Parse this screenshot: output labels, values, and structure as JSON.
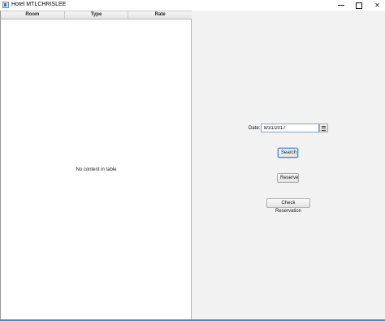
{
  "window": {
    "title": "Hotel MTLCHRISLEE",
    "minimize_icon": "minimize-icon",
    "maximize_icon": "maximize-icon",
    "close_glyph": "✕"
  },
  "table": {
    "columns": [
      "Room",
      "Type",
      "Rate"
    ],
    "empty_message": "No content in table"
  },
  "form": {
    "date_label": "Date:",
    "date_value": "8/31/2017",
    "calendar_icon": "calendar-icon",
    "search_label": "Search",
    "reserve_label": "Reserve",
    "check_label": "Check Reservation"
  },
  "colors": {
    "accent": "#3a8fd8",
    "panel_background": "#f2f2f2"
  }
}
